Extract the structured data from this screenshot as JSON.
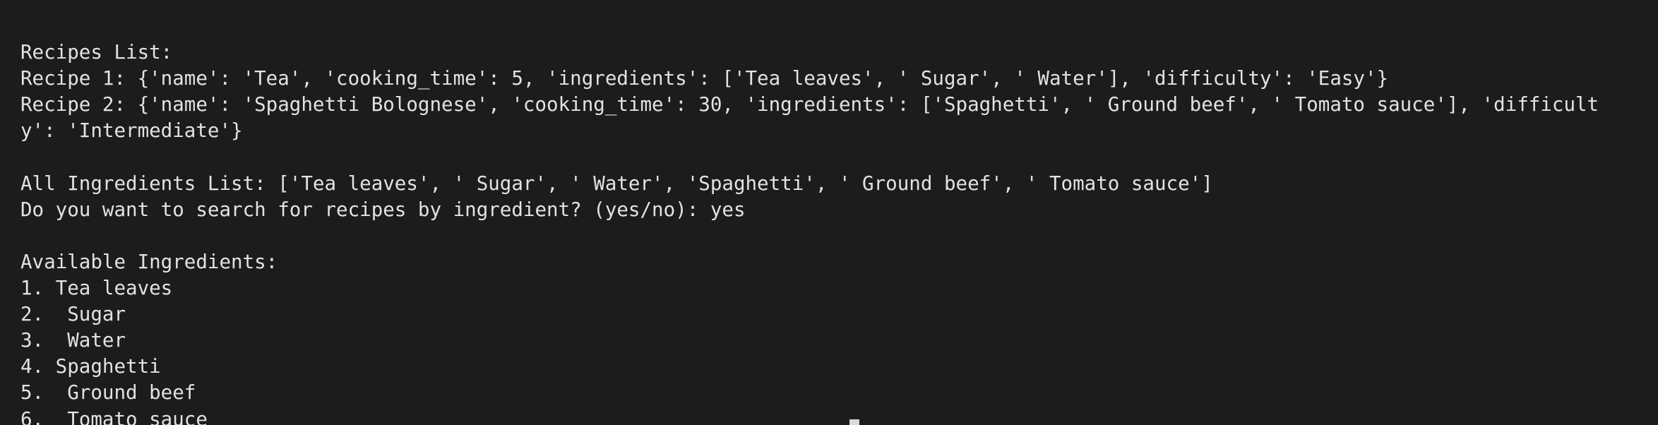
{
  "terminal": {
    "background": "#1c1c1c",
    "foreground": "#e2e2e2",
    "lines": [
      "  ",
      "",
      "Recipes List:",
      "Recipe 1: {'name': 'Tea', 'cooking_time': 5, 'ingredients': ['Tea leaves', ' Sugar', ' Water'], 'difficulty': 'Easy'}",
      "Recipe 2: {'name': 'Spaghetti Bolognese', 'cooking_time': 30, 'ingredients': ['Spaghetti', ' Ground beef', ' Tomato sauce'], 'difficult",
      "y': 'Intermediate'}",
      "",
      "All Ingredients List: ['Tea leaves', ' Sugar', ' Water', 'Spaghetti', ' Ground beef', ' Tomato sauce']",
      "Do you want to search for recipes by ingredient? (yes/no): yes",
      "",
      "Available Ingredients:",
      "1. Tea leaves",
      "2.  Sugar",
      "3.  Water",
      "4. Spaghetti",
      "5.  Ground beef",
      "6.  Tomato sauce"
    ]
  }
}
